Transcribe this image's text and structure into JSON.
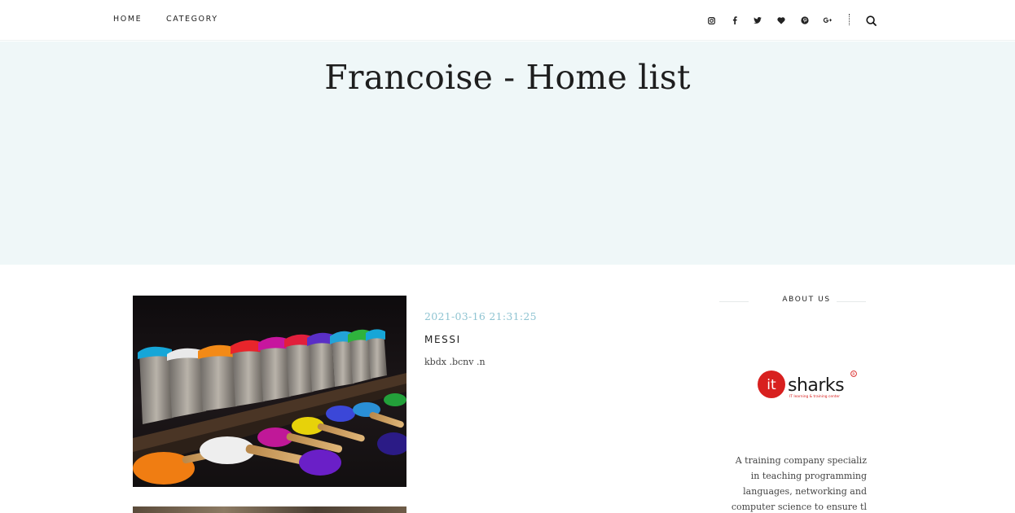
{
  "nav": {
    "home_label": "HOME",
    "category_label": "CATEGORY"
  },
  "social_icons": [
    "instagram-icon",
    "facebook-icon",
    "twitter-icon",
    "heart-icon",
    "pinterest-icon",
    "google-plus-icon"
  ],
  "hero": {
    "title": "Francoise - Home list"
  },
  "post": {
    "date": "2021-03-16 21:31:25",
    "title": "MESSI",
    "excerpt": "kbdx .bcnv .n"
  },
  "sidebar": {
    "about_heading": "ABOUT US",
    "logo_text": "sharks",
    "logo_badge_text": "it",
    "logo_tagline": "IT learning & training center",
    "about_lines": [
      "A training company specializ",
      "in teaching programming",
      "languages, networking and",
      "computer science to ensure tl"
    ]
  },
  "colors": {
    "hero_bg": "#eff7f8",
    "date_accent": "#8fc4d2",
    "logo_red": "#d8201f"
  }
}
